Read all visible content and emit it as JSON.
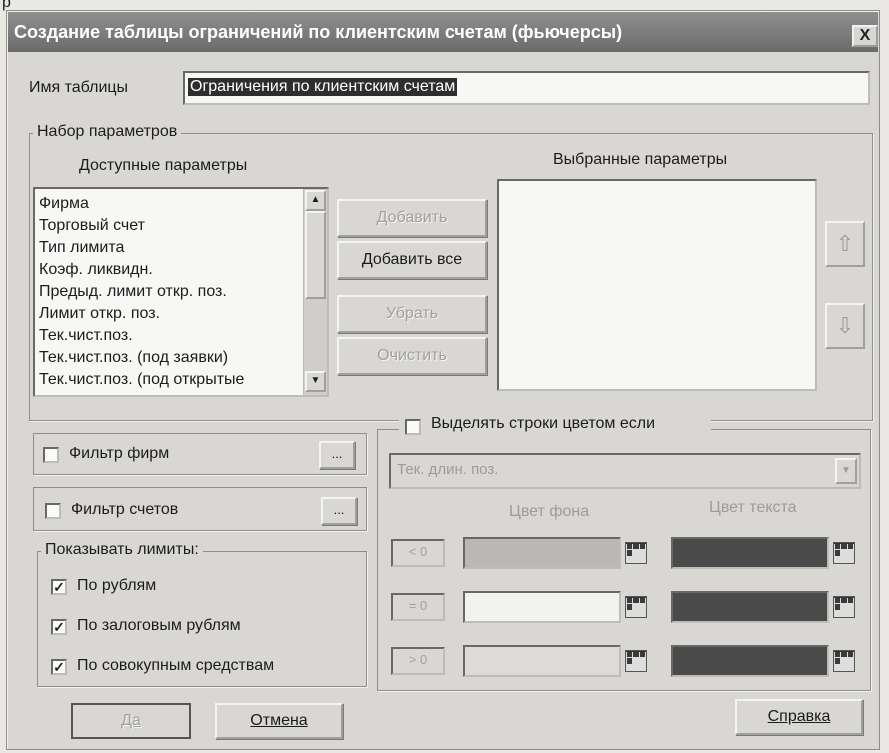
{
  "page_top_text": "р",
  "window": {
    "title": "Создание таблицы ограничений по клиентским счетам (фьючерсы)",
    "close_label": "X"
  },
  "table_name": {
    "label": "Имя таблицы",
    "value": "Ограничения по клиентским счетам"
  },
  "params": {
    "group_title": "Набор параметров",
    "available_title": "Доступные параметры",
    "selected_title": "Выбранные параметры",
    "available_items": [
      "Фирма",
      "Торговый счет",
      "Тип лимита",
      "Коэф. ликвидн.",
      "Предыд. лимит откр. поз.",
      "Лимит откр. поз.",
      "Тек.чист.поз.",
      "Тек.чист.поз. (под заявки)",
      "Тек.чист.поз. (под открытые"
    ],
    "selected_items": [],
    "add_label": "Добавить",
    "add_all_label": "Добавить все",
    "remove_label": "Убрать",
    "clear_label": "Очистить",
    "scroll_up": "▲",
    "scroll_down": "▼",
    "move_up": "⇧",
    "move_down": "⇩"
  },
  "filters": {
    "firms_label": "Фильтр фирм",
    "accounts_label": "Фильтр счетов",
    "ellipsis": "...",
    "firms_checked": false,
    "accounts_checked": false
  },
  "show_limits": {
    "title": "Показывать лимиты:",
    "items": [
      {
        "label": "По рублям",
        "checked": true,
        "check": "✓"
      },
      {
        "label": "По залоговым рублям",
        "checked": true,
        "check": "✓"
      },
      {
        "label": "По совокупным средствам",
        "checked": true,
        "check": "✓"
      }
    ]
  },
  "highlight": {
    "checkbox_label": "Выделять строки цветом если",
    "checked": false,
    "combo_value": "Тек. длин. поз.",
    "combo_arrow": "▼",
    "bg_color_header": "Цвет фона",
    "text_color_header": "Цвет текста",
    "rows": [
      {
        "op": "< 0",
        "bg_color": "#b9b8b5",
        "text_color": "#4a4a4a"
      },
      {
        "op": "= 0",
        "bg_color": "#f2f2f0",
        "text_color": "#4a4a4a"
      },
      {
        "op": "> 0",
        "bg_color": "#dcdbd8",
        "text_color": "#4a4a4a"
      }
    ]
  },
  "footer": {
    "ok_label": "Да",
    "cancel_label": "Отмена",
    "help_label": "Справка"
  }
}
